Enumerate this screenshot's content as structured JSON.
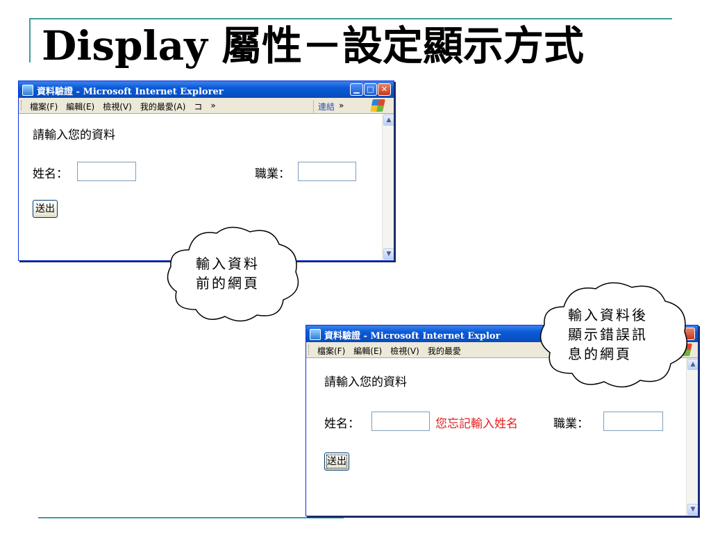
{
  "slide": {
    "title": "Display 屬性－設定顯示方式"
  },
  "window_before": {
    "title": "資料驗證 - Microsoft Internet Explorer",
    "window_controls": {
      "minimize": "▁",
      "maximize": "□",
      "close": "✕"
    },
    "menu": [
      "檔案(F)",
      "編輯(E)",
      "檢視(V)",
      "我的最愛(A)",
      "コ"
    ],
    "menu_more": "»",
    "links_label": "連結",
    "links_more": "»",
    "heading": "請輸入您的資料",
    "name_label": "姓名：",
    "name_value": "",
    "job_label": "職業：",
    "job_value": "",
    "submit_label": "送出",
    "scroll_up": "▲",
    "scroll_down": "▼"
  },
  "window_after": {
    "title": "資料驗證 - Microsoft Internet Explor",
    "menu": [
      "檔案(F)",
      "編輯(E)",
      "檢視(V)",
      "我的最愛"
    ],
    "heading": "請輸入您的資料",
    "name_label": "姓名：",
    "name_value": "",
    "error_message": "您忘記輸入姓名",
    "job_label": "職業：",
    "job_value": "",
    "submit_label": "送出",
    "scroll_up": "▲",
    "scroll_down": "▼"
  },
  "callout_before": {
    "text": "輸入資料\n前的網頁"
  },
  "callout_after": {
    "text": "輸入資料後\n顯示錯誤訊\n息的網頁"
  },
  "colors": {
    "accent_rule": "#3c9c9e",
    "titlebar": "#0a5ad6",
    "error_text": "#e02020",
    "input_border": "#7f9db9"
  },
  "icons": [
    "ie-app-icon",
    "minimize-icon",
    "maximize-icon",
    "close-icon",
    "windows-xp-logo-icon",
    "scroll-up-icon",
    "scroll-down-icon"
  ]
}
